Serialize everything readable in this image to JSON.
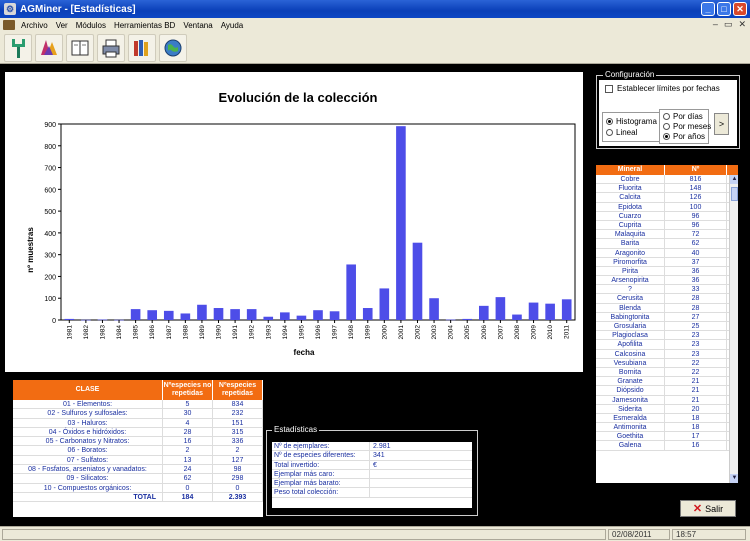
{
  "window": {
    "title": "AGMiner - [Estadísticas]"
  },
  "menu": {
    "items": [
      "Archivo",
      "Ver",
      "Módulos",
      "Herramientas BD",
      "Ventana",
      "Ayuda"
    ]
  },
  "toolbar": {
    "icons": [
      "tuning-fork-icon",
      "crystal-icon",
      "book-icon",
      "printer-icon",
      "books-icon",
      "globe-icon"
    ]
  },
  "chart_data": {
    "type": "bar",
    "title": "Evolución de la colección",
    "xlabel": "fecha",
    "ylabel": "nº muestras",
    "ylim": [
      0,
      900
    ],
    "yticks": [
      0,
      100,
      200,
      300,
      400,
      500,
      600,
      700,
      800,
      900
    ],
    "categories": [
      "1981",
      "1982",
      "1983",
      "1984",
      "1985",
      "1986",
      "1987",
      "1988",
      "1989",
      "1990",
      "1991",
      "1992",
      "1993",
      "1994",
      "1995",
      "1996",
      "1997",
      "1998",
      "1999",
      "2000",
      "2001",
      "2002",
      "2003",
      "2004",
      "2005",
      "2006",
      "2007",
      "2008",
      "2009",
      "2010",
      "2011"
    ],
    "values": [
      5,
      1,
      2,
      1,
      50,
      45,
      42,
      30,
      70,
      55,
      50,
      50,
      15,
      35,
      20,
      45,
      40,
      255,
      55,
      145,
      890,
      355,
      100,
      2,
      5,
      65,
      105,
      25,
      80,
      75,
      95
    ],
    "bar_color": "#4d4de8",
    "grid": false
  },
  "config": {
    "legend": "Configuración",
    "checkbox_label": "Establecer límites por fechas",
    "checkbox_checked": false,
    "chart_types": [
      {
        "label": "Histograma",
        "selected": true
      },
      {
        "label": "Lineal",
        "selected": false
      }
    ],
    "periods": [
      {
        "label": "Por días",
        "selected": false
      },
      {
        "label": "Por meses",
        "selected": false
      },
      {
        "label": "Por años",
        "selected": true
      }
    ],
    "go_label": ">"
  },
  "minerals": {
    "headers": [
      "Mineral",
      "Nº"
    ],
    "rows": [
      [
        "Cobre",
        "816"
      ],
      [
        "Fluorita",
        "148"
      ],
      [
        "Calcita",
        "126"
      ],
      [
        "Epidota",
        "100"
      ],
      [
        "Cuarzo",
        "96"
      ],
      [
        "Cuprita",
        "96"
      ],
      [
        "Malaquita",
        "72"
      ],
      [
        "Barita",
        "62"
      ],
      [
        "Aragonito",
        "40"
      ],
      [
        "Piromorfita",
        "37"
      ],
      [
        "Pirita",
        "36"
      ],
      [
        "Arsenopirita",
        "36"
      ],
      [
        "?",
        "33"
      ],
      [
        "Cerusita",
        "28"
      ],
      [
        "Blenda",
        "28"
      ],
      [
        "Babingtonita",
        "27"
      ],
      [
        "Grosularia",
        "25"
      ],
      [
        "Plagioclasa",
        "23"
      ],
      [
        "Apofilita",
        "23"
      ],
      [
        "Calcosina",
        "23"
      ],
      [
        "Vesubiana",
        "22"
      ],
      [
        "Bornita",
        "22"
      ],
      [
        "Granate",
        "21"
      ],
      [
        "Diópsido",
        "21"
      ],
      [
        "Jamesonita",
        "21"
      ],
      [
        "Siderita",
        "20"
      ],
      [
        "Esmeralda",
        "18"
      ],
      [
        "Antimonita",
        "18"
      ],
      [
        "Goethita",
        "17"
      ],
      [
        "Galena",
        "16"
      ]
    ]
  },
  "clases": {
    "headers": [
      "CLASE",
      "Nºespecies no repetidas",
      "Nºespecies repetidas"
    ],
    "rows": [
      [
        "01 - Elementos:",
        "5",
        "834"
      ],
      [
        "02 - Sulfuros y sulfosales:",
        "30",
        "232"
      ],
      [
        "03 - Haluros:",
        "4",
        "151"
      ],
      [
        "04 - Óxidos e hidróxidos:",
        "28",
        "315"
      ],
      [
        "05 - Carbonatos y Nitratos:",
        "16",
        "336"
      ],
      [
        "06 - Boratos:",
        "2",
        "2"
      ],
      [
        "07 - Sulfatos:",
        "13",
        "127"
      ],
      [
        "08 - Fosfatos, arseniatos y vanadatos:",
        "24",
        "98"
      ],
      [
        "09 - Silicatos:",
        "62",
        "298"
      ],
      [
        "10 - Compuestos orgánicos:",
        "0",
        "0"
      ]
    ],
    "total": {
      "label": "TOTAL",
      "a": "184",
      "b": "2.393"
    }
  },
  "stats": {
    "legend": "Estadísticas",
    "rows": [
      [
        "Nº de ejemplares:",
        "2.981"
      ],
      [
        "Nº de especies diferentes:",
        "341"
      ],
      [
        "Total invertido:",
        "€"
      ],
      [
        "Ejemplar más caro:",
        ""
      ],
      [
        "Ejemplar más barato:",
        ""
      ],
      [
        "Peso total colección:",
        ""
      ]
    ]
  },
  "salir_label": "Salir",
  "status": {
    "date": "02/08/2011",
    "time": "18:57"
  }
}
